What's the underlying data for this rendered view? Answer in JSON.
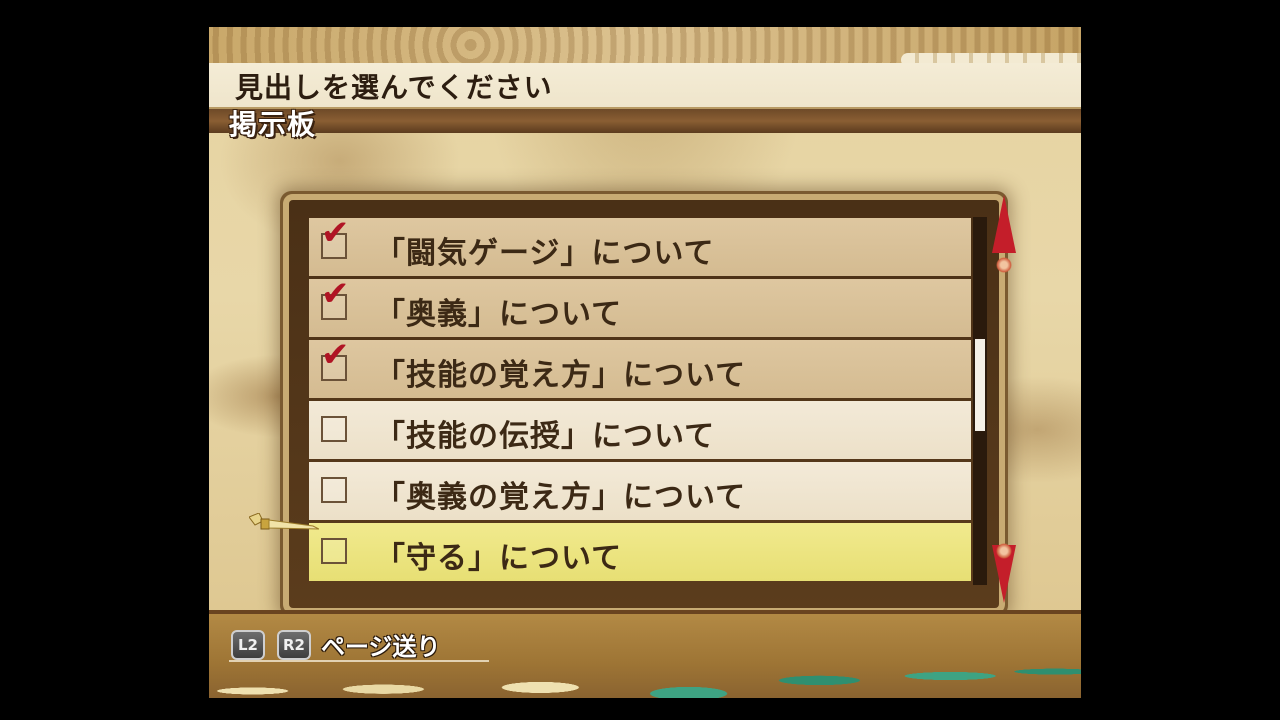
{
  "header": {
    "prompt": "見出しを選んでください"
  },
  "category": {
    "label": "掲示板"
  },
  "topics": [
    {
      "label": "「闘気ゲージ」について",
      "read": true
    },
    {
      "label": "「奥義」について",
      "read": true
    },
    {
      "label": "「技能の覚え方」について",
      "read": true
    },
    {
      "label": "「技能の伝授」について",
      "read": false
    },
    {
      "label": "「奥義の覚え方」について",
      "read": false
    },
    {
      "label": "「守る」について",
      "read": false,
      "selected": true
    }
  ],
  "footer": {
    "l2": "L2",
    "r2": "R2",
    "hint": "ページ送り"
  },
  "colors": {
    "check": "#b01424",
    "scroll_arrow": "#c41e2a",
    "selected_row": "#efe680"
  }
}
